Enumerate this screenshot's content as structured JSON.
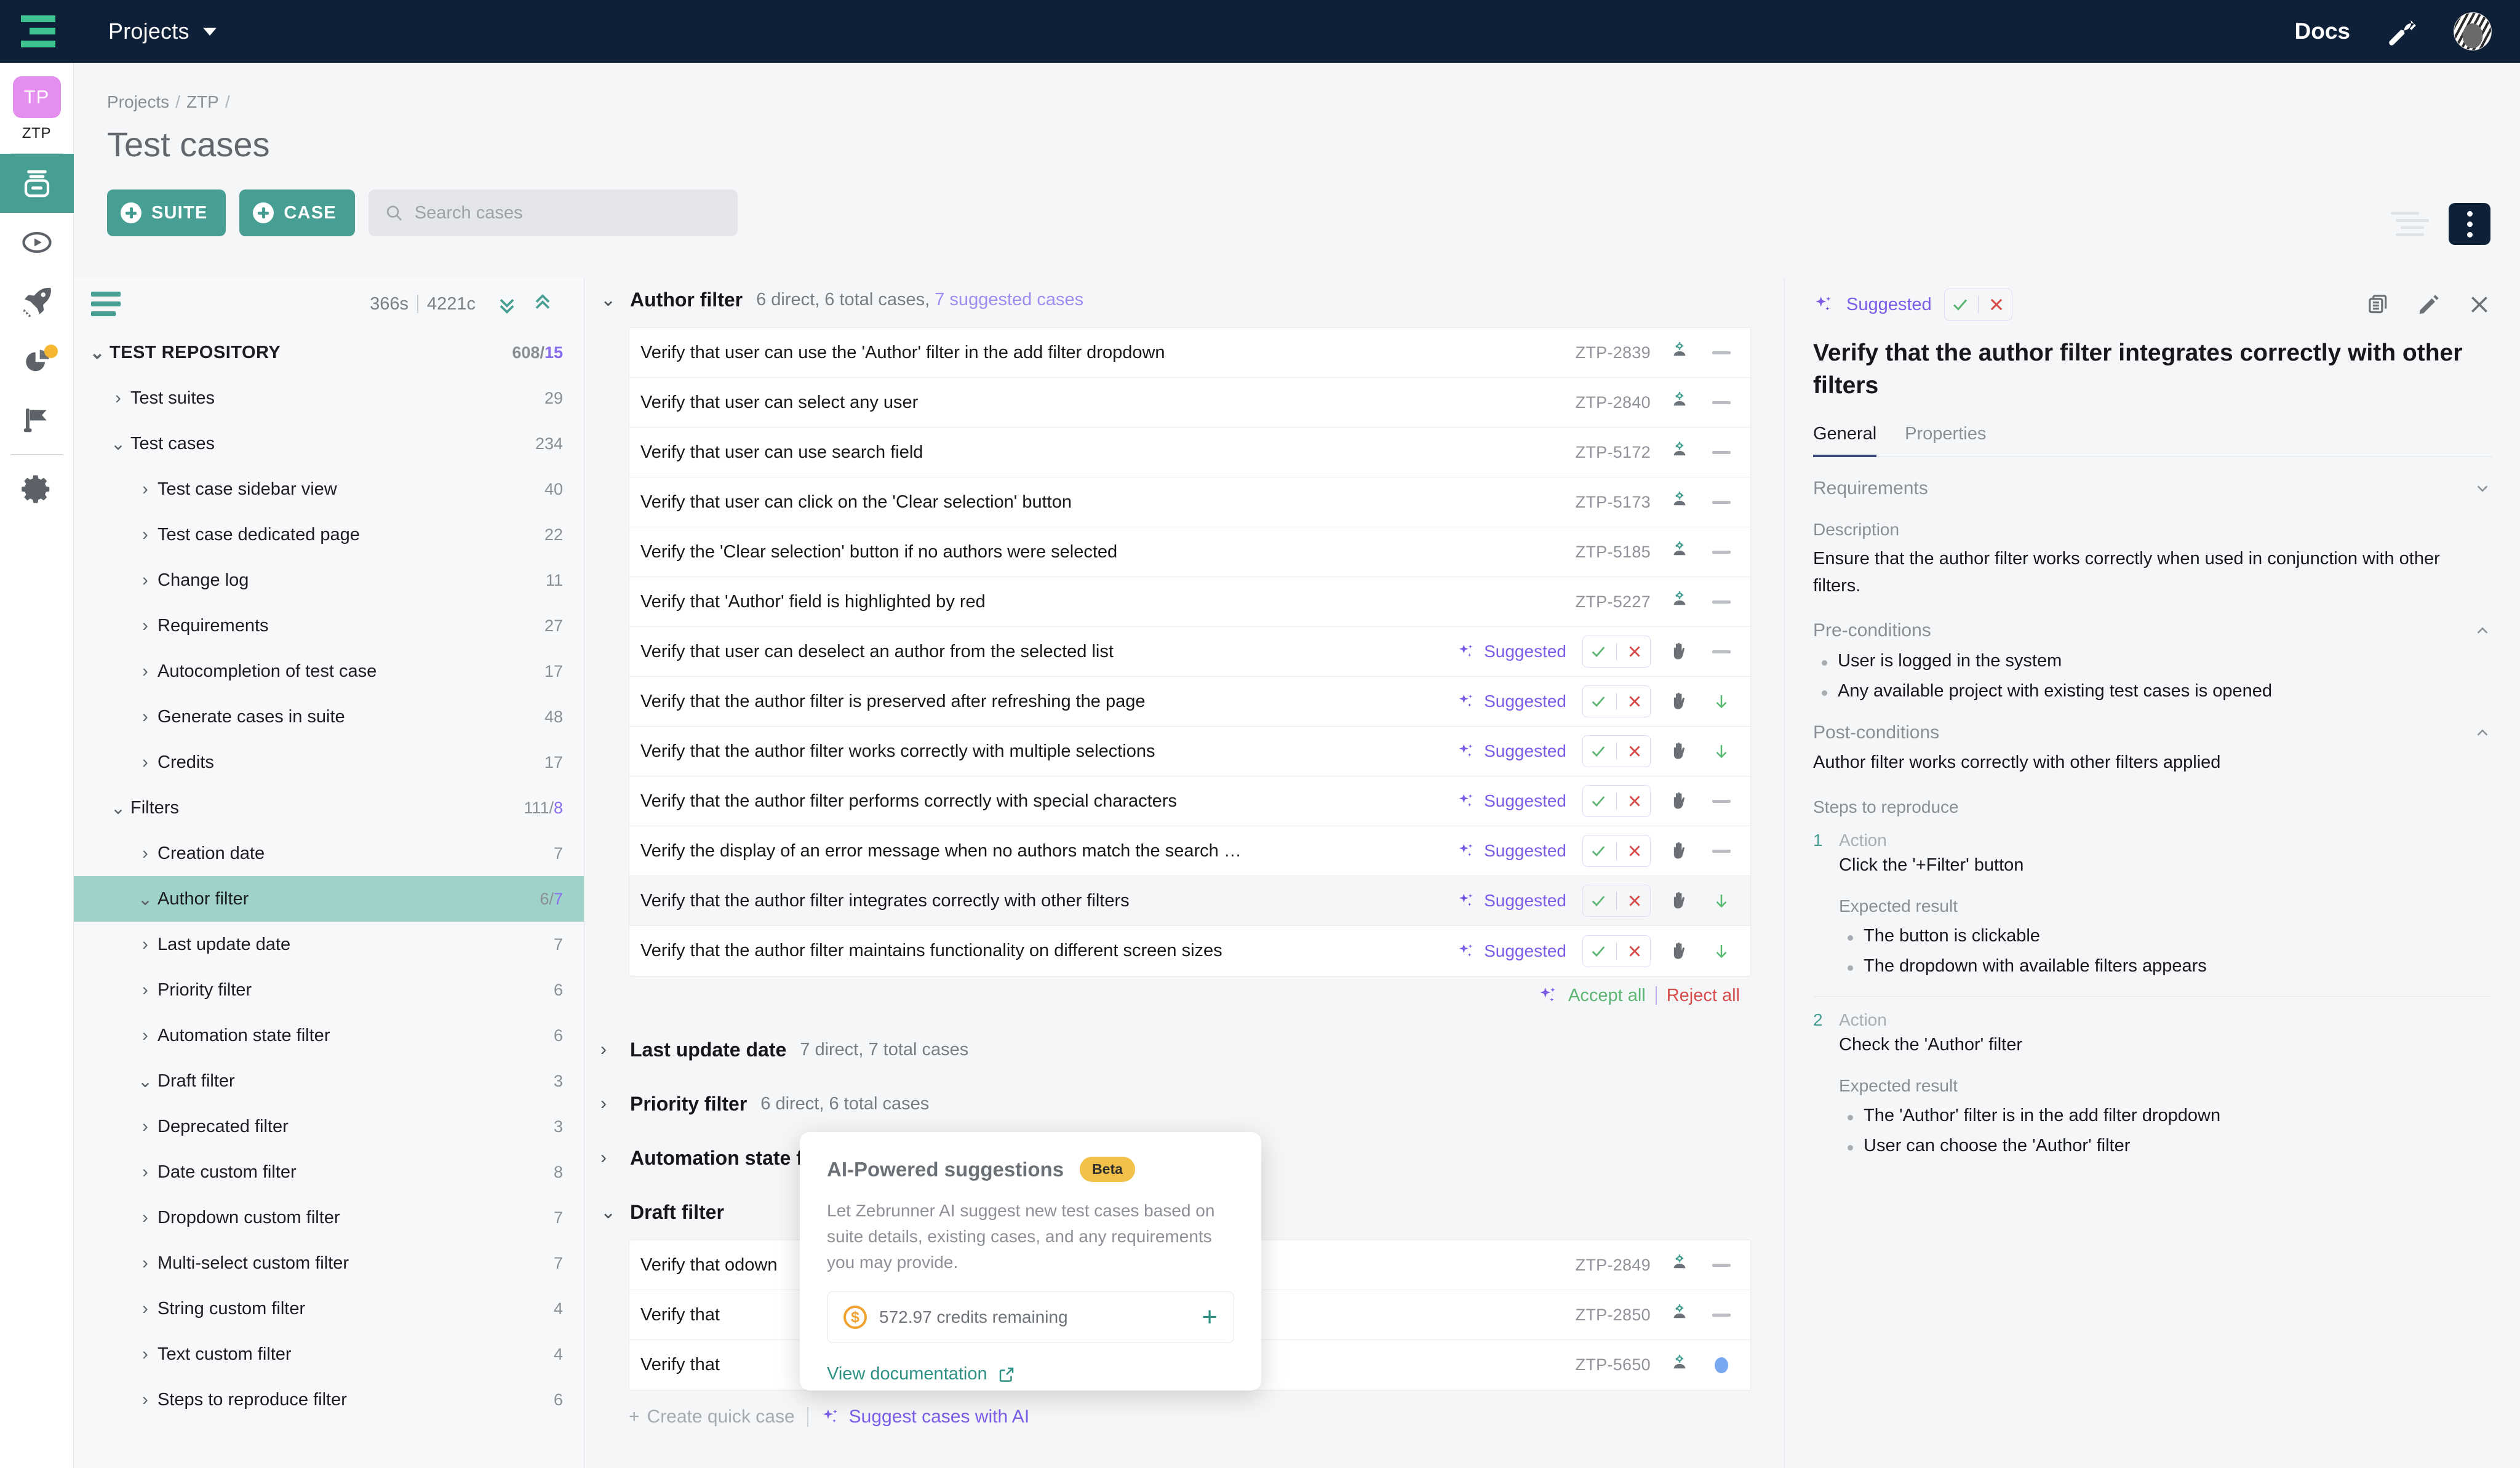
{
  "topnav": {
    "logo_name": "zebrunner-logo",
    "projects_label": "Projects",
    "docs_label": "Docs",
    "wrench_icon": "wrench-icon",
    "avatar_icon": "user-avatar"
  },
  "rail": {
    "project_initials": "TP",
    "project_code": "ZTP",
    "items": [
      {
        "icon": "test-repository-icon",
        "active": true
      },
      {
        "icon": "test-runs-play-icon",
        "active": false
      },
      {
        "icon": "launcher-rocket-icon",
        "active": false
      },
      {
        "icon": "reporting-pie-icon",
        "active": false,
        "badge": true
      },
      {
        "icon": "milestones-flag-icon",
        "active": false
      },
      {
        "icon": "settings-gear-icon",
        "active": false
      }
    ]
  },
  "header": {
    "breadcrumb": [
      "Projects",
      "ZTP"
    ],
    "title": "Test cases",
    "suite_button": "SUITE",
    "case_button": "CASE",
    "search_placeholder": "Search cases",
    "search_value": ""
  },
  "tree": {
    "stats_time": "366s",
    "stats_cases": "4221c",
    "expand_all_icon": "chevrons-down-icon",
    "collapse_all_icon": "chevrons-up-icon",
    "burger_icon": "tree-menu-icon",
    "nodes": [
      {
        "label": "TEST REPOSITORY",
        "count": "608/",
        "count_hl": "15",
        "level": 0,
        "open": true,
        "selected": false
      },
      {
        "label": "Test suites",
        "count": "29",
        "count_hl": "",
        "level": 1,
        "open": false,
        "selected": false
      },
      {
        "label": "Test cases",
        "count": "234",
        "count_hl": "",
        "level": 1,
        "open": true,
        "selected": false
      },
      {
        "label": "Test case sidebar view",
        "count": "40",
        "count_hl": "",
        "level": 2,
        "open": false,
        "selected": false
      },
      {
        "label": "Test case dedicated page",
        "count": "22",
        "count_hl": "",
        "level": 2,
        "open": false,
        "selected": false
      },
      {
        "label": "Change log",
        "count": "11",
        "count_hl": "",
        "level": 2,
        "open": false,
        "selected": false
      },
      {
        "label": "Requirements",
        "count": "27",
        "count_hl": "",
        "level": 2,
        "open": false,
        "selected": false
      },
      {
        "label": "Autocompletion of test case",
        "count": "17",
        "count_hl": "",
        "level": 2,
        "open": false,
        "selected": false
      },
      {
        "label": "Generate cases in suite",
        "count": "48",
        "count_hl": "",
        "level": 2,
        "open": false,
        "selected": false
      },
      {
        "label": "Credits",
        "count": "17",
        "count_hl": "",
        "level": 2,
        "open": false,
        "selected": false
      },
      {
        "label": "Filters",
        "count": "111/",
        "count_hl": "8",
        "level": 1,
        "open": true,
        "selected": false
      },
      {
        "label": "Creation date",
        "count": "7",
        "count_hl": "",
        "level": 2,
        "open": false,
        "selected": false
      },
      {
        "label": "Author filter",
        "count": "6/",
        "count_hl": "7",
        "level": 2,
        "open": true,
        "selected": true
      },
      {
        "label": "Last update date",
        "count": "7",
        "count_hl": "",
        "level": 2,
        "open": false,
        "selected": false
      },
      {
        "label": "Priority filter",
        "count": "6",
        "count_hl": "",
        "level": 2,
        "open": false,
        "selected": false
      },
      {
        "label": "Automation state filter",
        "count": "6",
        "count_hl": "",
        "level": 2,
        "open": false,
        "selected": false
      },
      {
        "label": "Draft filter",
        "count": "3",
        "count_hl": "",
        "level": 2,
        "open": true,
        "selected": false
      },
      {
        "label": "Deprecated filter",
        "count": "3",
        "count_hl": "",
        "level": 2,
        "open": false,
        "selected": false
      },
      {
        "label": "Date custom filter",
        "count": "8",
        "count_hl": "",
        "level": 2,
        "open": false,
        "selected": false
      },
      {
        "label": "Dropdown custom filter",
        "count": "7",
        "count_hl": "",
        "level": 2,
        "open": false,
        "selected": false
      },
      {
        "label": "Multi-select custom filter",
        "count": "7",
        "count_hl": "",
        "level": 2,
        "open": false,
        "selected": false
      },
      {
        "label": "String custom filter",
        "count": "4",
        "count_hl": "",
        "level": 2,
        "open": false,
        "selected": false
      },
      {
        "label": "Text custom filter",
        "count": "4",
        "count_hl": "",
        "level": 2,
        "open": false,
        "selected": false
      },
      {
        "label": "Steps to reproduce filter",
        "count": "6",
        "count_hl": "",
        "level": 2,
        "open": false,
        "selected": false
      }
    ]
  },
  "main": {
    "sections": [
      {
        "name": "Author filter",
        "meta": "6 direct, 6 total cases,",
        "meta_suggested": "7 suggested cases",
        "open": true
      },
      {
        "name": "Last update date",
        "meta": "7 direct, 7 total cases",
        "meta_suggested": "",
        "open": false
      },
      {
        "name": "Priority filter",
        "meta": "6 direct, 6 total cases",
        "meta_suggested": "",
        "open": false
      },
      {
        "name": "Automation state filter",
        "meta": "",
        "meta_suggested": "",
        "open": false
      },
      {
        "name": "Draft filter",
        "meta": "",
        "meta_suggested": "",
        "open": true
      }
    ],
    "author_rows": [
      {
        "title": "Verify that user can use the 'Author' filter in the add filter dropdown",
        "id": "ZTP-2839",
        "suggested": false,
        "trailing": "dash",
        "hl": false
      },
      {
        "title": "Verify that user can select any user",
        "id": "ZTP-2840",
        "suggested": false,
        "trailing": "dash",
        "hl": false
      },
      {
        "title": "Verify that user can use search field",
        "id": "ZTP-5172",
        "suggested": false,
        "trailing": "dash",
        "hl": false
      },
      {
        "title": "Verify that user can click on the 'Clear selection' button",
        "id": "ZTP-5173",
        "suggested": false,
        "trailing": "dash",
        "hl": false
      },
      {
        "title": "Verify the 'Clear selection' button if no authors were selected",
        "id": "ZTP-5185",
        "suggested": false,
        "trailing": "dash",
        "hl": false
      },
      {
        "title": "Verify that 'Author' field is highlighted by red",
        "id": "ZTP-5227",
        "suggested": false,
        "trailing": "dash",
        "hl": false
      },
      {
        "title": "Verify that user can deselect an author from the selected list",
        "id": "",
        "suggested": true,
        "trailing": "dash",
        "hl": false
      },
      {
        "title": "Verify that the author filter is preserved after refreshing the page",
        "id": "",
        "suggested": true,
        "trailing": "arrow",
        "hl": false
      },
      {
        "title": "Verify that the author filter works correctly with multiple selections",
        "id": "",
        "suggested": true,
        "trailing": "arrow",
        "hl": false
      },
      {
        "title": "Verify that the author filter performs correctly with special characters",
        "id": "",
        "suggested": true,
        "trailing": "dash",
        "hl": false
      },
      {
        "title": "Verify the display of an error message when no authors match the search …",
        "id": "",
        "suggested": true,
        "trailing": "dash",
        "hl": false
      },
      {
        "title": "Verify that the author filter integrates correctly with other filters",
        "id": "",
        "suggested": true,
        "trailing": "arrow",
        "hl": true
      },
      {
        "title": "Verify that the author filter maintains functionality on different screen sizes",
        "id": "",
        "suggested": true,
        "trailing": "arrow",
        "hl": false
      }
    ],
    "suggested_label": "Suggested",
    "accept_all": "Accept all",
    "reject_all": "Reject all",
    "draft_rows": [
      {
        "title": "Verify that",
        "title_tail": "odown",
        "id": "ZTP-2849",
        "trailing": "dash"
      },
      {
        "title": "Verify that",
        "title_tail": "",
        "id": "ZTP-2850",
        "trailing": "dash"
      },
      {
        "title": "Verify that",
        "title_tail": "",
        "id": "ZTP-5650",
        "trailing": "bluedot"
      }
    ],
    "create_quick_case": "Create quick case",
    "suggest_with_ai": "Suggest cases with AI"
  },
  "ai_popover": {
    "title": "AI-Powered suggestions",
    "badge": "Beta",
    "description": "Let Zebrunner AI suggest new test cases based on suite details, existing cases, and any requirements you may provide.",
    "credits": "572.97 credits remaining",
    "coin_icon": "coin-icon",
    "add_credits_icon": "plus-icon",
    "view_documentation": "View documentation",
    "external_icon": "external-link-icon"
  },
  "right_panel": {
    "status": "Suggested",
    "accept_icon": "check-icon",
    "reject_icon": "cross-icon",
    "copy_icon": "duplicate-icon",
    "edit_icon": "pencil-icon",
    "close_icon": "close-icon",
    "title": "Verify that the author filter integrates correctly with other filters",
    "tabs": [
      {
        "label": "General",
        "active": true
      },
      {
        "label": "Properties",
        "active": false
      }
    ],
    "requirements_label": "Requirements",
    "description_label": "Description",
    "description": "Ensure that the author filter works correctly when used in conjunction with other filters.",
    "preconditions_label": "Pre-conditions",
    "preconditions": [
      "User is logged in the system",
      "Any available project with existing test cases is opened"
    ],
    "postconditions_label": "Post-conditions",
    "postconditions": "Author filter works correctly with other filters applied",
    "steps_label": "Steps to reproduce",
    "action_label": "Action",
    "expected_label": "Expected result",
    "steps": [
      {
        "num": "1",
        "action": "Click the '+Filter' button",
        "expected": [
          "The button is clickable",
          "The dropdown with available filters appears"
        ]
      },
      {
        "num": "2",
        "action": "Check the 'Author' filter",
        "expected": [
          "The 'Author' filter is in the add filter dropdown",
          "User can choose the 'Author' filter"
        ]
      }
    ]
  },
  "colors": {
    "navy": "#0e2038",
    "teal": "#479e92",
    "teal_selected": "#9fd3c9",
    "purple": "#7b5ce8",
    "purple_light": "#a08bf0",
    "green": "#5cb573",
    "red": "#d74b4b",
    "amber": "#f2c14a",
    "pink": "#e48ff0",
    "logo_green": "#3ec28f"
  }
}
